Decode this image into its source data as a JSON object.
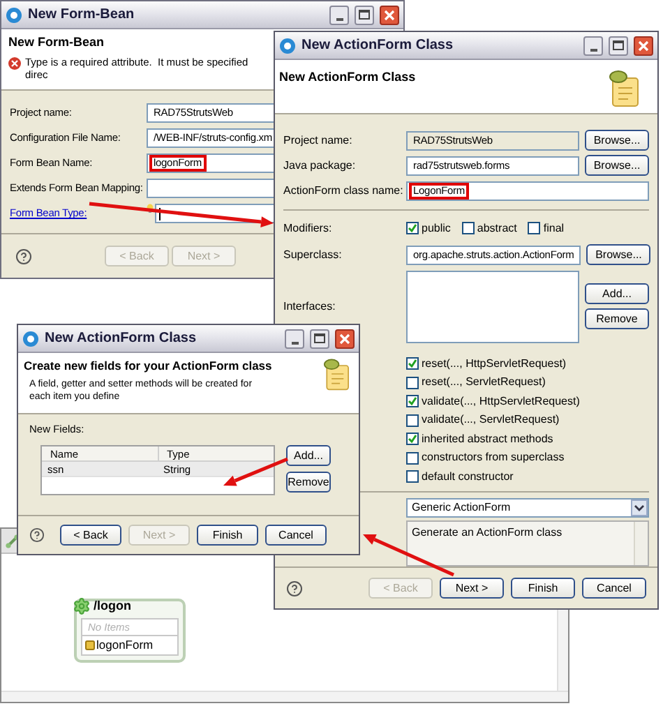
{
  "form_bean_dialog": {
    "title": "New Form-Bean",
    "heading": "New Form-Bean",
    "error": "Type is a required attribute.  It must be specified direc",
    "fields": [
      {
        "label": "Project name:",
        "value": "RAD75StrutsWeb",
        "highlighted": false,
        "kind": "text"
      },
      {
        "label": "Configuration File Name:",
        "value": "/WEB-INF/struts-config.xm",
        "highlighted": false,
        "kind": "text"
      },
      {
        "label": "Form Bean Name:",
        "value": "logonForm",
        "highlighted": true,
        "kind": "text"
      },
      {
        "label": "Extends Form Bean Mapping:",
        "highlighted": false,
        "kind": "text"
      },
      {
        "label": "Form Bean Type:",
        "highlighted": false,
        "kind": "link"
      }
    ],
    "buttons": [
      {
        "label": "< Back",
        "disabled": true
      },
      {
        "label": "Next >",
        "disabled": true
      }
    ]
  },
  "actionform_dialog": {
    "title": "New ActionForm Class",
    "heading": "New ActionForm Class",
    "fields": [
      {
        "label": "Project name:",
        "value": "RAD75StrutsWeb",
        "readonly": true,
        "highlighted": false,
        "button": "Browse..."
      },
      {
        "label": "Java package:",
        "value": "rad75strutsweb.forms",
        "readonly": false,
        "highlighted": false,
        "button": "Browse..."
      },
      {
        "label": "ActionForm class name:",
        "value": "LogonForm",
        "readonly": false,
        "highlighted": true
      }
    ],
    "modifiers_label": "Modifiers:",
    "modifiers": [
      {
        "label": "public",
        "checked": true
      },
      {
        "label": "abstract",
        "checked": false
      },
      {
        "label": "final",
        "checked": false
      }
    ],
    "superclass": {
      "label": "Superclass:",
      "value": "org.apache.struts.action.ActionForm",
      "button": "Browse..."
    },
    "interfaces": {
      "label": "Interfaces:",
      "buttons": [
        "Add...",
        "Remove"
      ]
    },
    "methods": [
      {
        "label": "reset(..., HttpServletRequest)",
        "checked": true
      },
      {
        "label": "reset(..., ServletRequest)",
        "checked": false
      },
      {
        "label": "validate(..., HttpServletRequest)",
        "checked": true
      },
      {
        "label": "validate(..., ServletRequest)",
        "checked": false
      },
      {
        "label": "inherited abstract methods",
        "checked": true
      },
      {
        "label": "constructors from superclass",
        "checked": false
      },
      {
        "label": "default constructor",
        "checked": false
      }
    ],
    "template": {
      "value": "Generic ActionForm",
      "description": "Generate an ActionForm class"
    },
    "buttons": [
      {
        "label": "< Back",
        "disabled": true
      },
      {
        "label": "Next >",
        "disabled": false
      },
      {
        "label": "Finish",
        "disabled": false
      },
      {
        "label": "Cancel",
        "disabled": false
      }
    ]
  },
  "fields_dialog": {
    "title": "New ActionForm Class",
    "heading": "Create new fields for your ActionForm class",
    "description": [
      "A field, getter and setter methods will be created for",
      "each item you define"
    ],
    "list_label": "New Fields:",
    "columns": [
      "Name",
      "Type"
    ],
    "rows": [
      [
        "ssn",
        "String"
      ]
    ],
    "side_buttons": [
      "Add...",
      "Remove"
    ],
    "buttons": [
      {
        "label": "< Back",
        "disabled": false
      },
      {
        "label": "Next >",
        "disabled": true
      },
      {
        "label": "Finish",
        "disabled": false
      },
      {
        "label": "Cancel",
        "disabled": false
      }
    ]
  },
  "editor": {
    "node": {
      "title": "/logon",
      "empty_label": "No Items",
      "items": [
        "logonForm"
      ]
    }
  }
}
